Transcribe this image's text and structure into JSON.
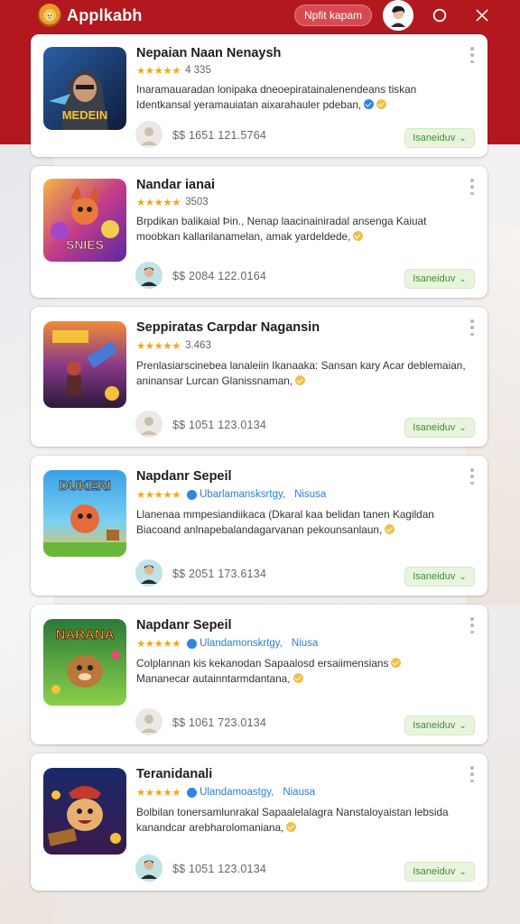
{
  "header": {
    "app_title": "Applkabh",
    "pill_label": "Npfit kapam",
    "logo_icon": "lion-logo-icon",
    "colors": {
      "brand_red": "#b3181f",
      "accent_green": "#3e8f2e",
      "star_gold": "#f4a81a",
      "link_blue": "#2b7fd6"
    }
  },
  "cards": [
    {
      "title": "Nepaian Naan Nenaysh",
      "stars": "★★★★★",
      "rating": "4 335",
      "developer": "",
      "developer_extra": "",
      "desc_line1": "Inaramauaradan lonipaka dneoepiratainalenendeans tiskan",
      "desc_line2": "Identkansal yeramauiatan aixarahauler pdeban,",
      "price": "$$ 1651 121.5764",
      "action_label": "Isaneiduv"
    },
    {
      "title": "Nandar ianai",
      "stars": "★★★★★",
      "rating": "3503",
      "developer": "",
      "developer_extra": "",
      "desc_line1": "Brpdikan balikaial  Þin., Nenap laacinainiradal ansenga Kaiuat",
      "desc_line2": "moobkan kallarilanamelan, amak yardeldede,",
      "price": "$$ 2084 122.0164",
      "action_label": "Isaneiduv"
    },
    {
      "title": "Seppiratas Carpdar Nagansin",
      "stars": "★★★★★",
      "rating": "3.463",
      "developer": "",
      "developer_extra": "",
      "desc_line1": "Prenlasiarscinebea  lanaleiin Ikanaaka: Sansan kary Acar deblemaian,",
      "desc_line2": "aninansar Lurcan Glanissnaman,",
      "price": "$$ 1051 123.0134",
      "action_label": "Isaneiduv"
    },
    {
      "title": "Napdanr Sepeil",
      "stars": "★★★★★",
      "rating": "",
      "developer": "Ubarlamansksrtgy,",
      "developer_extra": "Nisusa",
      "desc_line1": "Llanenaa mmpesiandiikaca (Dkaral kaa belidan tanen Kagildan",
      "desc_line2": "Biacoand anlnapebalandagarvanan pekounsanlaun,",
      "price": "$$ 2051 173.6134",
      "action_label": "Isaneiduv"
    },
    {
      "title": "Napdanr Sepeil",
      "stars": "★★★★★",
      "rating": "",
      "developer": "Ulandamonskrtgy,",
      "developer_extra": "Niusa",
      "desc_line1": "Colplannan kis kekanodan Sapaalosd ersaiimensians",
      "desc_line2": "Mananecar autainntarmdantana,",
      "price": "$$ 1061 723.0134",
      "action_label": "Isaneiduv"
    },
    {
      "title": "Teranidanali",
      "stars": "★★★★★",
      "rating": "",
      "developer": "Ulandamoastgy,",
      "developer_extra": "Niausa",
      "desc_line1": "Bolbilan tonersamlunrakal Sapaalelalagra Nanstaloyaistan lebsida",
      "desc_line2": "kanandcar arebharolomaniana,",
      "price": "$$ 1051 123.0134",
      "action_label": "Isaneiduv"
    }
  ]
}
